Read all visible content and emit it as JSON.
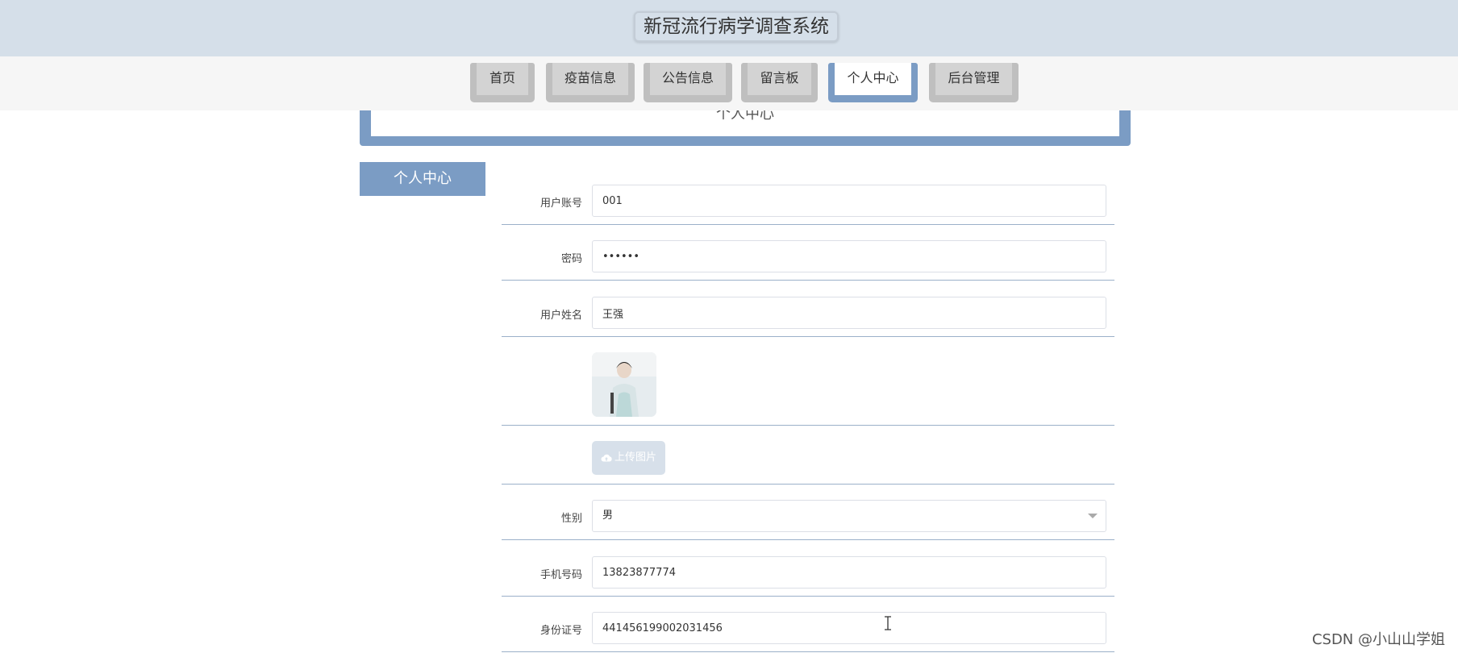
{
  "app": {
    "title": "新冠流行病学调查系统"
  },
  "nav": {
    "tabs": [
      {
        "label": "首页"
      },
      {
        "label": "疫苗信息"
      },
      {
        "label": "公告信息"
      },
      {
        "label": "留言板"
      },
      {
        "label": "个人中心",
        "active": true
      },
      {
        "label": "后台管理"
      }
    ]
  },
  "panel": {
    "title": "个人中心"
  },
  "sidebar": {
    "items": [
      {
        "label": "个人中心"
      }
    ]
  },
  "form": {
    "username": {
      "label": "用户账号",
      "value": "001"
    },
    "password": {
      "label": "密码",
      "value": "••••••"
    },
    "name": {
      "label": "用户姓名",
      "value": "王强"
    },
    "upload": {
      "label": "上传图片"
    },
    "gender": {
      "label": "性别",
      "value": "男"
    },
    "phone": {
      "label": "手机号码",
      "value": "13823877774"
    },
    "idcard": {
      "label": "身份证号",
      "value": "441456199002031456"
    }
  },
  "watermark": "CSDN @小山山学姐",
  "colors": {
    "accent": "#7b9cc4",
    "header": "#d5dfe9",
    "tab": "#bfbfbf"
  }
}
